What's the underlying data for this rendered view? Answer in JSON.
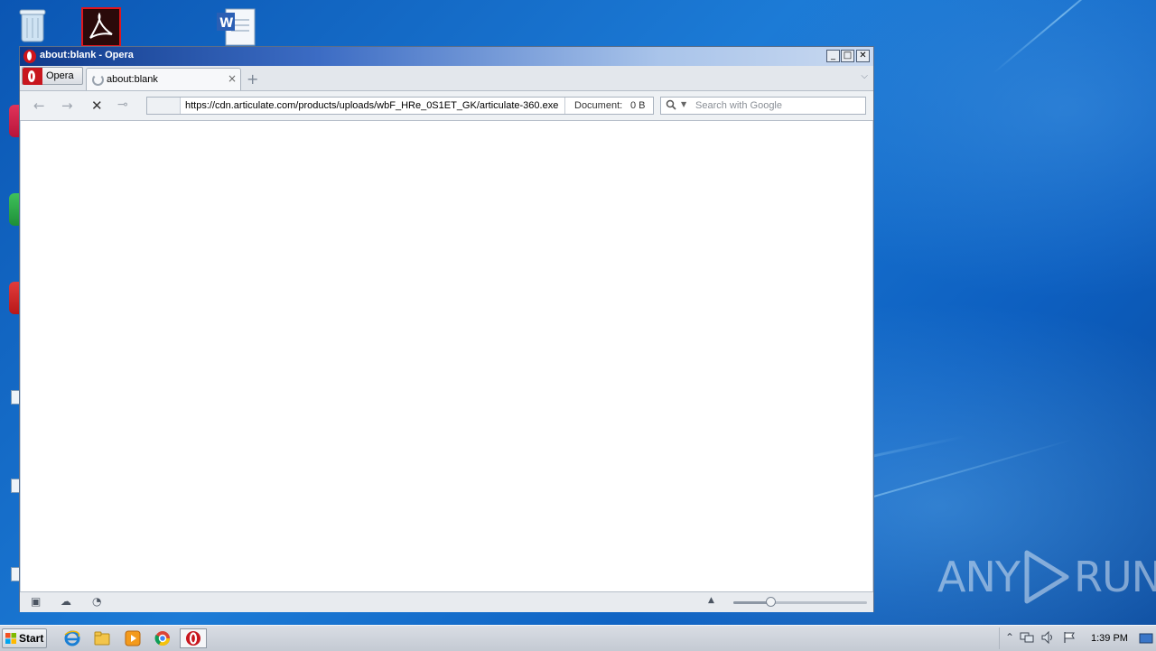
{
  "window": {
    "title": "about:blank - Opera",
    "minimize": "_",
    "maximize": "□",
    "close": "✕"
  },
  "tabs": {
    "opera_menu_label": "Opera",
    "active_tab_label": "about:blank",
    "close_glyph": "×",
    "new_tab_glyph": "+",
    "tab_menu_glyph": "⌵"
  },
  "nav": {
    "back_glyph": "←",
    "forward_glyph": "→",
    "stop_glyph": "✕",
    "key_glyph": "⊸",
    "url": "https://cdn.articulate.com/products/uploads/wbF_HRe_0S1ET_GK/articulate-360.exe",
    "document_label": "Document:",
    "document_size": "0 B",
    "search_placeholder": "Search with Google"
  },
  "statusbar": {
    "panel_glyph": "▣",
    "cloud_glyph": "☁",
    "speed_glyph": "◔",
    "zoom_up_glyph": "▲",
    "zoom_level_percent": 28
  },
  "taskbar": {
    "start_label": "Start",
    "tray_chevron": "⌃",
    "clock": "1:39 PM"
  },
  "watermark": {
    "text_left": "ANY",
    "text_right": "RUN"
  },
  "colors": {
    "accent_title": "#0f3a8a",
    "opera_red": "#c8161e",
    "desktop_blue": "#1c7bd6"
  }
}
